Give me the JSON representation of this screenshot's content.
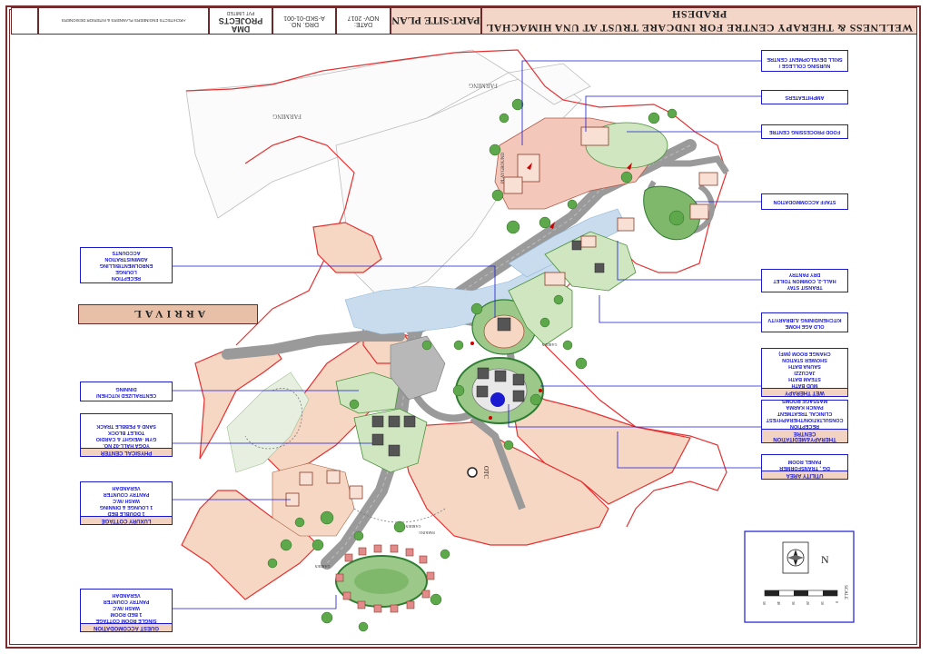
{
  "title_block": {
    "project_title": "WELLNESS & THERAPY CENTRE FOR INDCARE TRUST AT UNA HIMACHAL PRADESH",
    "sheet_title": "PART-SITE PLAN",
    "date_label": "DATE:",
    "date_value": "NOV- 2017",
    "drg_label": "DRG. NO.",
    "drg_value": "A-SKD-01-001",
    "firm_name": "DMA PROJECTS",
    "firm_tag": "PVT LIMITED",
    "firm_address": "ARCHITECTS ENGINEERS PLANNERS & INTERIOR DESIGNERS"
  },
  "arrival_label": "ARRIVAL",
  "callouts": {
    "nursing": {
      "lines": [
        "NURSING COLLEGE /",
        "SKILL DEVELOPMENT CENTRE"
      ]
    },
    "amphitheaters": {
      "lines": [
        "AMPHITEATERS"
      ]
    },
    "food": {
      "lines": [
        "FOOD PROCESSING CENTRE"
      ]
    },
    "staff": {
      "lines": [
        "STAFF ACCOMMODATION"
      ]
    },
    "transit": {
      "lines": [
        "TRANSIT STAY",
        "HALL-2, COMMON TOILET",
        "DRY PANTRY"
      ]
    },
    "oldage": {
      "lines": [
        "OLD AGE HOME",
        "KITCHEN/DINING /LIBRARY/TV"
      ]
    },
    "wet": {
      "head": "WET THERAPY",
      "lines": [
        "MUD BATH",
        "STEAM BATH",
        "JACUZZI",
        "SAUNA BATH",
        "SHOWER STATION",
        "CHANGE ROOM (M/F)"
      ]
    },
    "therapy": {
      "head": "THERAPY&MEDITATION CENTRE",
      "lines": [
        "RECEPTION",
        "CONSULTATION/THERAPHYEST",
        "CLINICAL TREATMENT",
        "PANCH KARMA",
        "MASSAGE ROOMS"
      ]
    },
    "utility": {
      "head": "UTILITY AREA",
      "lines": [
        "DG , TRANSFORMER",
        "PANEL ROOM"
      ]
    },
    "reception": {
      "lines": [
        "RECEPTION",
        "LOUNGE",
        "ENROLMENT/BILLING",
        "ADMINISTRATION",
        "ACCOUNTS"
      ]
    },
    "kitchen": {
      "lines": [
        "CENTRALIZED KITCHEN/",
        "DINNING"
      ]
    },
    "physical": {
      "head": "PHYSICAL CENTER",
      "lines": [
        "YOGA HALL-02 NO.",
        "GYM -WEIGHT & CARDIO",
        "TOILET BLOCK",
        "SAND & PEBBLE TRACK"
      ]
    },
    "luxury": {
      "head": "LUXURY COTTAGE",
      "lines": [
        "1 DOUBLE BED",
        "1 LOUNGE & DINNING",
        "WASH /W.C",
        "PANTRY COUNTER",
        "VERANDAH"
      ]
    },
    "guest": {
      "head": "GUEST ACCOMODATION",
      "lines": [
        "SINGLE ROOM COTTAGE",
        "1 BED ROOM",
        "WASH /W.C",
        "PANTRY COUNTER",
        "VERANDAH"
      ]
    }
  },
  "map_labels": {
    "farming_1": "FARMING",
    "farming_2": "FARMING",
    "playground": "PLAYGROUND",
    "otc": "OTC",
    "garden_1": "GARDEN",
    "garden_2": "GARDEN",
    "garden_3": "GARDEN",
    "parking": "PARKING"
  },
  "north": {
    "label": "N"
  },
  "scale": {
    "label": "SCALE",
    "ticks": [
      "0",
      "10",
      "20",
      "30",
      "40",
      "50"
    ]
  },
  "colors": {
    "boundary": "#e53030",
    "callout_blue": "#1a1ad0",
    "building_fill": "#f6d7c3",
    "lawn_green": "#5da84a",
    "road_gray": "#9a9a9a",
    "paving_blue": "#c8dcee",
    "title_fill": "#f4d6c8"
  }
}
